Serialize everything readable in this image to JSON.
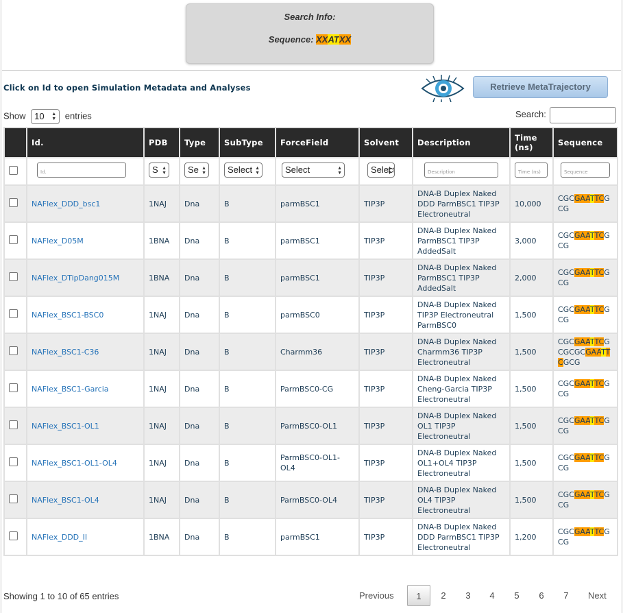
{
  "search_info": {
    "title": "Search Info:",
    "sequence_label": "Sequence: ",
    "sequence_parts": [
      {
        "text": "XX",
        "hl": "or"
      },
      {
        "text": "AT",
        "hl": "ye"
      },
      {
        "text": "XX",
        "hl": "or"
      }
    ]
  },
  "header": {
    "click_info": "Click on Id to open Simulation Metadata and Analyses",
    "retrieve_label": "Retrieve MetaTrajectory"
  },
  "controls": {
    "show_label": "Show",
    "entries_value": "10",
    "entries_label": "entries",
    "search_label": "Search:",
    "search_value": ""
  },
  "columns": [
    "Id.",
    "PDB",
    "Type",
    "SubType",
    "ForceField",
    "Solvent",
    "Description",
    "Time (ns)",
    "Sequence"
  ],
  "filters": {
    "id_placeholder": "Id.",
    "pdb": "S",
    "type": "Se",
    "subtype": "Select",
    "forcefield": "Select",
    "solvent": "Select",
    "description_placeholder": "Description",
    "time_placeholder": "Time (ns)",
    "sequence_placeholder": "Sequence"
  },
  "rows": [
    {
      "id": "NAFlex_DDD_bsc1",
      "pdb": "1NAJ",
      "type": "Dna",
      "subtype": "B",
      "forcefield": "parmBSC1",
      "solvent": "TIP3P",
      "description": "DNA-B Duplex Naked DDD ParmBSC1 TIP3P Electroneutral",
      "time": "10,000",
      "sequence": [
        {
          "t": "CGC"
        },
        {
          "t": "GAA",
          "h": "or"
        },
        {
          "t": "T",
          "h": "ye"
        },
        {
          "t": "TC",
          "h": "or"
        },
        {
          "t": "GCG"
        }
      ]
    },
    {
      "id": "NAFlex_D05M",
      "pdb": "1BNA",
      "type": "Dna",
      "subtype": "B",
      "forcefield": "parmBSC1",
      "solvent": "TIP3P",
      "description": "DNA-B Duplex Naked ParmBSC1 TIP3P AddedSalt",
      "time": "3,000",
      "sequence": [
        {
          "t": "CGC"
        },
        {
          "t": "GAA",
          "h": "or"
        },
        {
          "t": "T",
          "h": "ye"
        },
        {
          "t": "TC",
          "h": "or"
        },
        {
          "t": "GCG"
        }
      ]
    },
    {
      "id": "NAFlex_DTipDang015M",
      "pdb": "1BNA",
      "type": "Dna",
      "subtype": "B",
      "forcefield": "parmBSC1",
      "solvent": "TIP3P",
      "description": "DNA-B Duplex Naked ParmBSC1 TIP3P AddedSalt",
      "time": "2,000",
      "sequence": [
        {
          "t": "CGC"
        },
        {
          "t": "GAA",
          "h": "or"
        },
        {
          "t": "T",
          "h": "ye"
        },
        {
          "t": "TC",
          "h": "or"
        },
        {
          "t": "GCG"
        }
      ]
    },
    {
      "id": "NAFlex_BSC1-BSC0",
      "pdb": "1NAJ",
      "type": "Dna",
      "subtype": "B",
      "forcefield": "parmBSC0",
      "solvent": "TIP3P",
      "description": "DNA-B Duplex Naked TIP3P Electroneutral ParmBSC0",
      "time": "1,500",
      "sequence": [
        {
          "t": "CGC"
        },
        {
          "t": "GAA",
          "h": "or"
        },
        {
          "t": "T",
          "h": "ye"
        },
        {
          "t": "TC",
          "h": "or"
        },
        {
          "t": "GCG"
        }
      ]
    },
    {
      "id": "NAFlex_BSC1-C36",
      "pdb": "1NAJ",
      "type": "Dna",
      "subtype": "B",
      "forcefield": "Charmm36",
      "solvent": "TIP3P",
      "description": "DNA-B Duplex Naked Charmm36 TIP3P Electroneutral",
      "time": "1,500",
      "sequence": [
        {
          "t": "CGC"
        },
        {
          "t": "GAA",
          "h": "or"
        },
        {
          "t": "T",
          "h": "ye"
        },
        {
          "t": "TC",
          "h": "or"
        },
        {
          "t": "GCGCGC"
        },
        {
          "t": "GAA",
          "h": "or"
        },
        {
          "t": "T",
          "h": "ye"
        },
        {
          "t": "TC",
          "h": "or"
        },
        {
          "t": "GCG"
        }
      ]
    },
    {
      "id": "NAFlex_BSC1-Garcia",
      "pdb": "1NAJ",
      "type": "Dna",
      "subtype": "B",
      "forcefield": "ParmBSC0-CG",
      "solvent": "TIP3P",
      "description": "DNA-B Duplex Naked Cheng-Garcia TIP3P Electroneutral",
      "time": "1,500",
      "sequence": [
        {
          "t": "CGC"
        },
        {
          "t": "GAA",
          "h": "or"
        },
        {
          "t": "T",
          "h": "ye"
        },
        {
          "t": "TC",
          "h": "or"
        },
        {
          "t": "GCG"
        }
      ]
    },
    {
      "id": "NAFlex_BSC1-OL1",
      "pdb": "1NAJ",
      "type": "Dna",
      "subtype": "B",
      "forcefield": "ParmBSC0-OL1",
      "solvent": "TIP3P",
      "description": "DNA-B Duplex Naked OL1 TIP3P Electroneutral",
      "time": "1,500",
      "sequence": [
        {
          "t": "CGC"
        },
        {
          "t": "GAA",
          "h": "or"
        },
        {
          "t": "T",
          "h": "ye"
        },
        {
          "t": "TC",
          "h": "or"
        },
        {
          "t": "GCG"
        }
      ]
    },
    {
      "id": "NAFlex_BSC1-OL1-OL4",
      "pdb": "1NAJ",
      "type": "Dna",
      "subtype": "B",
      "forcefield": "ParmBSC0-OL1-OL4",
      "solvent": "TIP3P",
      "description": "DNA-B Duplex Naked OL1+OL4 TIP3P Electroneutral",
      "time": "1,500",
      "sequence": [
        {
          "t": "CGC"
        },
        {
          "t": "GAA",
          "h": "or"
        },
        {
          "t": "T",
          "h": "ye"
        },
        {
          "t": "TC",
          "h": "or"
        },
        {
          "t": "GCG"
        }
      ]
    },
    {
      "id": "NAFlex_BSC1-OL4",
      "pdb": "1NAJ",
      "type": "Dna",
      "subtype": "B",
      "forcefield": "ParmBSC0-OL4",
      "solvent": "TIP3P",
      "description": "DNA-B Duplex Naked OL4 TIP3P Electroneutral",
      "time": "1,500",
      "sequence": [
        {
          "t": "CGC"
        },
        {
          "t": "GAA",
          "h": "or"
        },
        {
          "t": "T",
          "h": "ye"
        },
        {
          "t": "TC",
          "h": "or"
        },
        {
          "t": "GCG"
        }
      ]
    },
    {
      "id": "NAFlex_DDD_II",
      "pdb": "1BNA",
      "type": "Dna",
      "subtype": "B",
      "forcefield": "parmBSC1",
      "solvent": "TIP3P",
      "description": "DNA-B Duplex Naked DDD ParmBSC1 TIP3P Electroneutral",
      "time": "1,200",
      "sequence": [
        {
          "t": "CGC"
        },
        {
          "t": "GAA",
          "h": "or"
        },
        {
          "t": "T",
          "h": "ye"
        },
        {
          "t": "TC",
          "h": "or"
        },
        {
          "t": "GCG"
        }
      ]
    }
  ],
  "footer": {
    "info": "Showing 1 to 10 of 65 entries",
    "previous": "Previous",
    "pages": [
      "1",
      "2",
      "3",
      "4",
      "5",
      "6",
      "7"
    ],
    "current_page": "1",
    "next": "Next"
  },
  "colors": {
    "highlight_orange": "#ff9e00",
    "highlight_yellow": "#ffe800",
    "header_bg": "#2a2a2a",
    "link": "#2472b8"
  }
}
